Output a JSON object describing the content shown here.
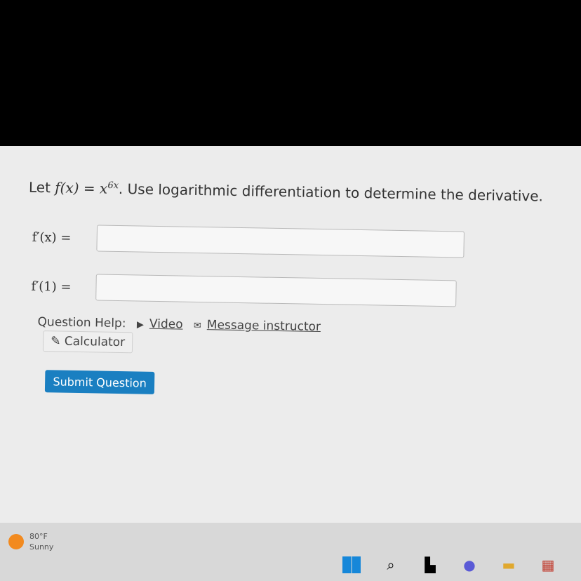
{
  "question": {
    "prefix": "Let ",
    "fx": "f(x)",
    "eq": " = ",
    "base": "x",
    "exponent": "6x",
    "suffix": ". Use logarithmic differentiation to determine the derivative."
  },
  "answers": [
    {
      "label": "f′(x) =",
      "value": ""
    },
    {
      "label": "f′(1) =",
      "value": ""
    }
  ],
  "help": {
    "label": "Question Help:",
    "video": "Video",
    "message": "Message instructor",
    "calculator": "Calculator"
  },
  "submit_label": "Submit Question",
  "taskbar": {
    "temperature": "80°F",
    "condition": "Sunny",
    "icons": [
      "windows-icon",
      "search-icon",
      "task-view-icon",
      "chat-icon",
      "folder-icon",
      "store-icon"
    ]
  }
}
